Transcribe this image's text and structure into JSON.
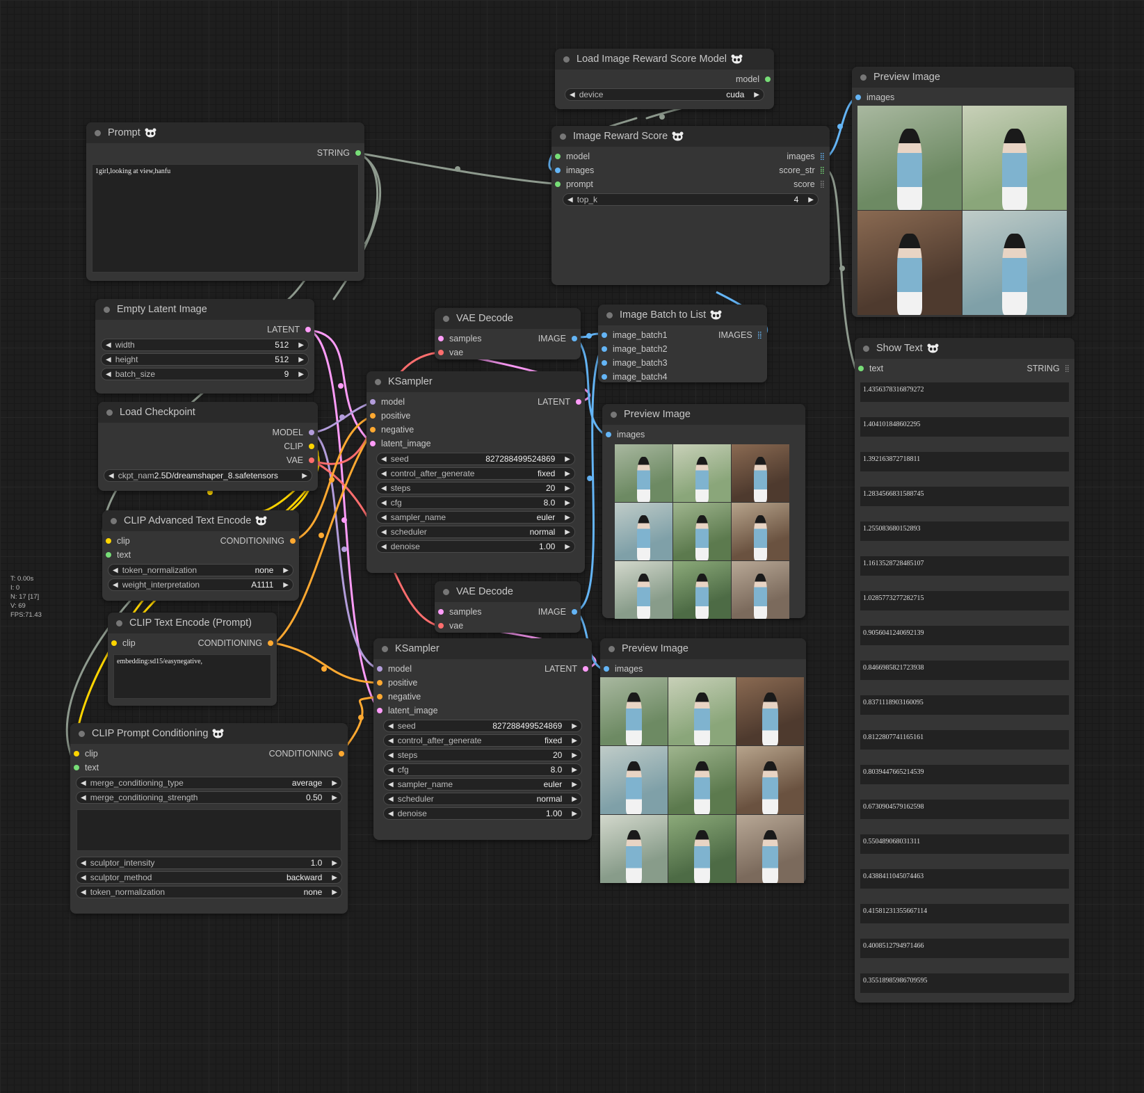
{
  "colors": {
    "model": "#b39ddb",
    "clip": "#ffd500",
    "vae": "#ff6e6e",
    "conditioning": "#ffa931",
    "latent": "#ff9cf9",
    "image": "#64b5f6",
    "string": "#77dd77",
    "link_string": "#8e9a8e"
  },
  "stats": [
    "T: 0.00s",
    "I: 0",
    "N: 17 [17]",
    "V: 69",
    "FPS:71.43"
  ],
  "nodes": {
    "prompt": {
      "title": "Prompt",
      "out": "STRING",
      "text": "1girl,looking at view,hanfu"
    },
    "empty_latent": {
      "title": "Empty Latent Image",
      "out": "LATENT",
      "widgets": [
        {
          "label": "width",
          "value": "512"
        },
        {
          "label": "height",
          "value": "512"
        },
        {
          "label": "batch_size",
          "value": "9"
        }
      ]
    },
    "load_checkpoint": {
      "title": "Load Checkpoint",
      "outs": [
        "MODEL",
        "CLIP",
        "VAE"
      ],
      "widget": {
        "label": "ckpt_nam",
        "value": "2.5D/dreamshaper_8.safetensors"
      }
    },
    "clip_adv": {
      "title": "CLIP Advanced Text Encode",
      "in1": "clip",
      "in2": "text",
      "out": "CONDITIONING",
      "widgets": [
        {
          "label": "token_normalization",
          "value": "none"
        },
        {
          "label": "weight_interpretation",
          "value": "A1111"
        }
      ]
    },
    "clip_text": {
      "title": "CLIP Text Encode (Prompt)",
      "in": "clip",
      "out": "CONDITIONING",
      "text": "embedding:sd15/easynegative,"
    },
    "clip_prompt": {
      "title": "CLIP Prompt Conditioning",
      "in1": "clip",
      "in2": "text",
      "out": "CONDITIONING",
      "widgets_a": [
        {
          "label": "merge_conditioning_type",
          "value": "average"
        },
        {
          "label": "merge_conditioning_strength",
          "value": "0.50"
        }
      ],
      "widgets_b": [
        {
          "label": "sculptor_intensity",
          "value": "1.0"
        },
        {
          "label": "sculptor_method",
          "value": "backward"
        },
        {
          "label": "token_normalization",
          "value": "none"
        }
      ]
    },
    "vae1": {
      "title": "VAE Decode",
      "in1": "samples",
      "in2": "vae",
      "out": "IMAGE"
    },
    "vae2": {
      "title": "VAE Decode",
      "in1": "samples",
      "in2": "vae",
      "out": "IMAGE"
    },
    "ksampler1": {
      "title": "KSampler",
      "ins": [
        "model",
        "positive",
        "negative",
        "latent_image"
      ],
      "out": "LATENT",
      "widgets": [
        {
          "label": "seed",
          "value": "827288499524869"
        },
        {
          "label": "control_after_generate",
          "value": "fixed"
        },
        {
          "label": "steps",
          "value": "20"
        },
        {
          "label": "cfg",
          "value": "8.0"
        },
        {
          "label": "sampler_name",
          "value": "euler"
        },
        {
          "label": "scheduler",
          "value": "normal"
        },
        {
          "label": "denoise",
          "value": "1.00"
        }
      ]
    },
    "ksampler2": {
      "title": "KSampler",
      "ins": [
        "model",
        "positive",
        "negative",
        "latent_image"
      ],
      "out": "LATENT",
      "widgets": [
        {
          "label": "seed",
          "value": "827288499524869"
        },
        {
          "label": "control_after_generate",
          "value": "fixed"
        },
        {
          "label": "steps",
          "value": "20"
        },
        {
          "label": "cfg",
          "value": "8.0"
        },
        {
          "label": "sampler_name",
          "value": "euler"
        },
        {
          "label": "scheduler",
          "value": "normal"
        },
        {
          "label": "denoise",
          "value": "1.00"
        }
      ]
    },
    "batch_to_list": {
      "title": "Image Batch to List",
      "ins": [
        "image_batch1",
        "image_batch2",
        "image_batch3",
        "image_batch4"
      ],
      "out": "IMAGES"
    },
    "preview_mid1": {
      "title": "Preview Image",
      "in": "images"
    },
    "preview_mid2": {
      "title": "Preview Image",
      "in": "images"
    },
    "reward_model": {
      "title": "Load Image Reward Score Model",
      "out": "model",
      "widget": {
        "label": "device",
        "value": "cuda"
      }
    },
    "reward_score": {
      "title": "Image Reward Score",
      "ins": [
        "model",
        "images",
        "prompt"
      ],
      "outs": [
        "images",
        "score_str",
        "score"
      ],
      "widget": {
        "label": "top_k",
        "value": "4"
      }
    },
    "preview_top": {
      "title": "Preview Image",
      "in": "images"
    },
    "show_text": {
      "title": "Show Text",
      "in": "text",
      "out": "STRING",
      "values": [
        "1.4356378316879272",
        "1.404101848602295",
        "1.392163872718811",
        "1.2834566831588745",
        "1.255083680152893",
        "1.1613528728485107",
        "1.0285773277282715",
        "0.9056041240692139",
        "0.8466985821723938",
        "0.8371118903160095",
        "0.8122807741165161",
        "0.8039447665214539",
        "0.6730904579162598",
        "0.550489068031311",
        "0.4388411045074463",
        "0.41581231355667114",
        "0.4008512794971466",
        "0.35518985986709595"
      ]
    }
  },
  "thumb_palettes": [
    [
      "#6d8a63",
      "#a9b8a0"
    ],
    [
      "#8aa67a",
      "#c8d0b8"
    ],
    [
      "#4e3a2e",
      "#8a6a52"
    ],
    [
      "#7fa0a8",
      "#c0ccc8"
    ],
    [
      "#5c7a4e",
      "#9fb58e"
    ],
    [
      "#6a5240",
      "#b7a48c"
    ],
    [
      "#889c8a",
      "#d3d8cc"
    ],
    [
      "#4d6b45",
      "#8caa7a"
    ],
    [
      "#7b6a5c",
      "#b8a896"
    ]
  ]
}
